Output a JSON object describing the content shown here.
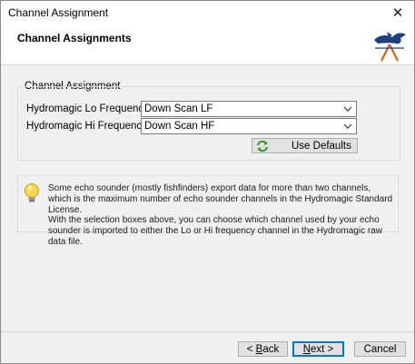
{
  "window": {
    "title": "Channel Assignment",
    "close_glyph": "✕"
  },
  "header": {
    "title": "Channel Assignments",
    "logo_icon": "hydromagic-logo-icon"
  },
  "group": {
    "label": "Channel Assignment",
    "lo": {
      "label": "Hydromagic Lo Frequency:",
      "value": "Down Scan LF"
    },
    "hi": {
      "label": "Hydromagic Hi Frequency:",
      "value": "Down Scan HF"
    },
    "defaults_button": "Use Defaults"
  },
  "info": {
    "icon": "lightbulb-icon",
    "para1": "Some echo sounder (mostly fishfinders) export data for more than two channels, which is the maximum number of echo sounder channels in the Hydromagic Standard License.",
    "para2": "With the selection boxes above, you can choose which channel used by your echo sounder is imported to either the Lo or Hi frequency channel in the Hydromagic raw data file."
  },
  "footer": {
    "back_prefix": "< ",
    "back_mnemonic": "B",
    "back_rest": "ack",
    "next_mnemonic": "N",
    "next_rest": "ext >",
    "cancel": "Cancel"
  }
}
